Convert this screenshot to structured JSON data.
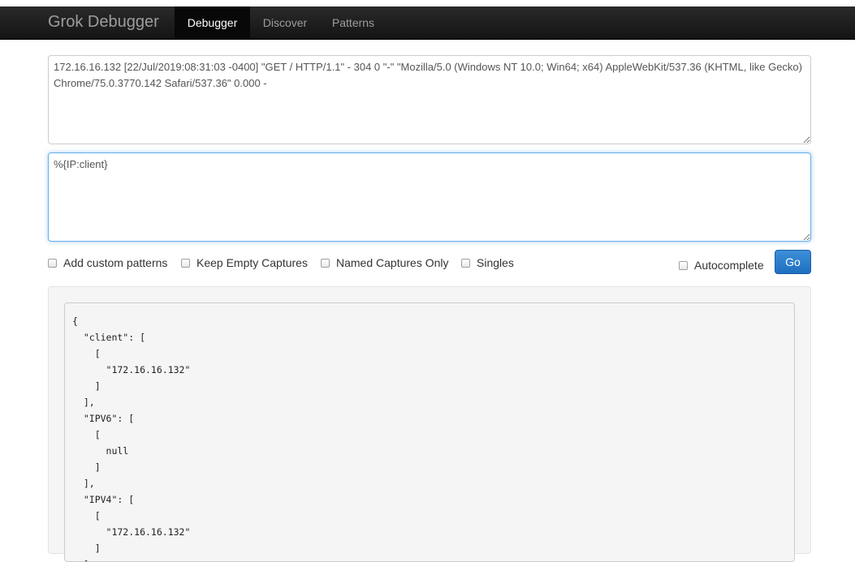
{
  "navbar": {
    "brand": "Grok Debugger",
    "items": [
      {
        "label": "Debugger",
        "active": true
      },
      {
        "label": "Discover",
        "active": false
      },
      {
        "label": "Patterns",
        "active": false
      }
    ]
  },
  "log_input": {
    "value": "172.16.16.132 [22/Jul/2019:08:31:03 -0400] \"GET / HTTP/1.1\" - 304 0 \"-\" \"Mozilla/5.0 (Windows NT 10.0; Win64; x64) AppleWebKit/537.36 (KHTML, like Gecko) Chrome/75.0.3770.142 Safari/537.36\" 0.000 -"
  },
  "pattern_input": {
    "value": "%{IP:client}"
  },
  "options": {
    "add_custom_patterns": {
      "label": "Add custom patterns",
      "checked": false
    },
    "keep_empty_captures": {
      "label": "Keep Empty Captures",
      "checked": false
    },
    "named_captures_only": {
      "label": "Named Captures Only",
      "checked": false
    },
    "singles": {
      "label": "Singles",
      "checked": false
    },
    "autocomplete": {
      "label": "Autocomplete",
      "checked": false
    }
  },
  "go_button": {
    "label": "Go"
  },
  "result": {
    "text": "{\n  \"client\": [\n    [\n      \"172.16.16.132\"\n    ]\n  ],\n  \"IPV6\": [\n    [\n      null\n    ]\n  ],\n  \"IPV4\": [\n    [\n      \"172.16.16.132\"\n    ]\n  ]\n}"
  },
  "colors": {
    "navbar_bg": "#222222",
    "active_tab_bg": "#080808",
    "go_button": "#2f80d0",
    "focus_border": "#66afe9"
  }
}
